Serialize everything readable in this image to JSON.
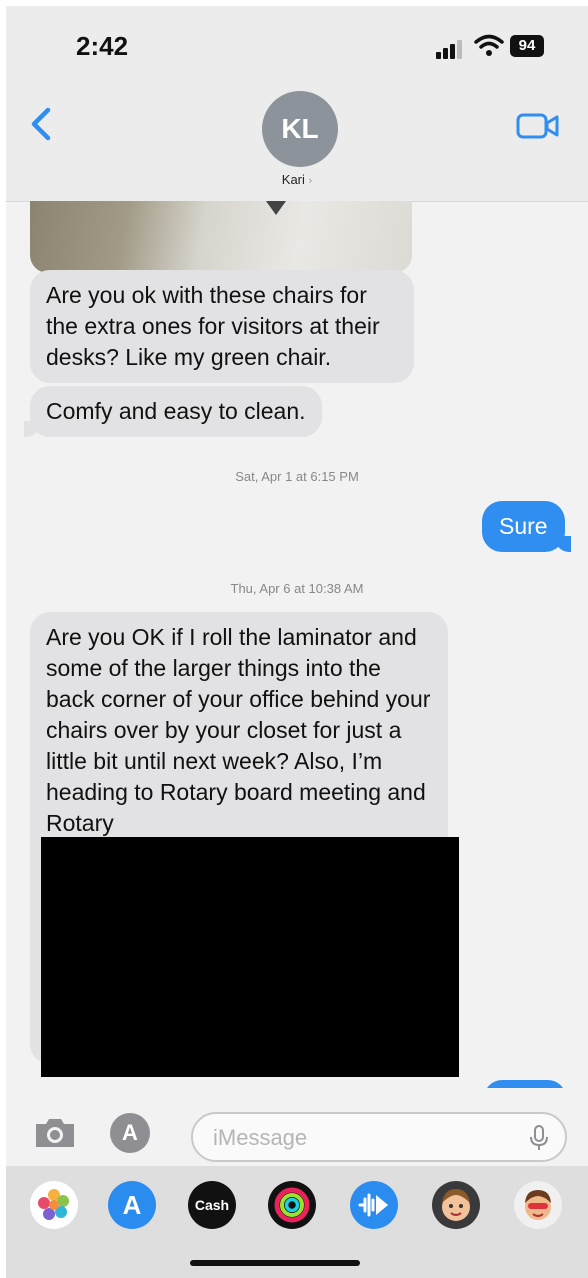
{
  "status_bar": {
    "time": "2:42",
    "battery": "94"
  },
  "header": {
    "avatar_initials": "KL",
    "contact_name": "Kari",
    "contact_chevron": "›"
  },
  "messages": [
    {
      "type": "incoming",
      "text": "Are you ok with these chairs for the extra ones for visitors at their desks? Like my green chair."
    },
    {
      "type": "incoming",
      "text": "Comfy and easy to clean."
    },
    {
      "type": "timestamp",
      "text": "Sat, Apr 1 at 6:15 PM"
    },
    {
      "type": "outgoing",
      "text": "Sure"
    },
    {
      "type": "timestamp",
      "text": "Thu, Apr 6 at 10:38 AM"
    },
    {
      "type": "incoming",
      "text": "Are you OK if I roll the laminator and some of the larger things into the back corner of your office behind your chairs over by your closet for just a little bit until next week? Also, I’m heading to Rotary board meeting and Rotary"
    }
  ],
  "composer": {
    "placeholder": "iMessage",
    "value": ""
  },
  "app_tray": [
    {
      "name": "photos-app",
      "label": ""
    },
    {
      "name": "app-store-app",
      "label": "A"
    },
    {
      "name": "apple-cash-app",
      "label": "Cash"
    },
    {
      "name": "activity-app",
      "label": ""
    },
    {
      "name": "audio-message-app",
      "label": ""
    },
    {
      "name": "memoji-app",
      "label": ""
    },
    {
      "name": "memoji-stickers-app",
      "label": ""
    }
  ],
  "colors": {
    "accent": "#2f8ef0",
    "incoming_bubble": "#e2e2e4"
  }
}
